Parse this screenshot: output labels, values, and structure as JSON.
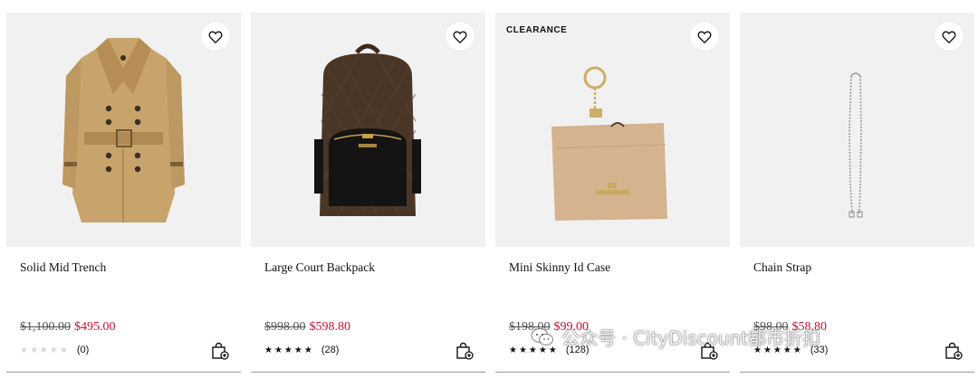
{
  "products": [
    {
      "badge": "",
      "title": "Solid Mid Trench",
      "original_price": "$1,100.00",
      "sale_price": "$495.00",
      "rating_stars": 0,
      "review_count": "(0)"
    },
    {
      "badge": "",
      "title": "Large Court Backpack",
      "original_price": "$998.00",
      "sale_price": "$598.80",
      "rating_stars": 5,
      "review_count": "(28)"
    },
    {
      "badge": "CLEARANCE",
      "title": "Mini Skinny Id Case",
      "original_price": "$198.00",
      "sale_price": "$99.00",
      "rating_stars": 5,
      "review_count": "(128)"
    },
    {
      "badge": "",
      "title": "Chain Strap",
      "original_price": "$98.00",
      "sale_price": "$58.80",
      "rating_stars": 5,
      "review_count": "(33)"
    }
  ],
  "watermark": {
    "text": "公众号 · CityDiscount都市折扣"
  },
  "colors": {
    "sale": "#c8102e",
    "card_bg": "#f1f1f1",
    "text": "#111111"
  },
  "icons": [
    "heart-outline-icon",
    "add-to-bag-icon",
    "wechat-icon"
  ]
}
